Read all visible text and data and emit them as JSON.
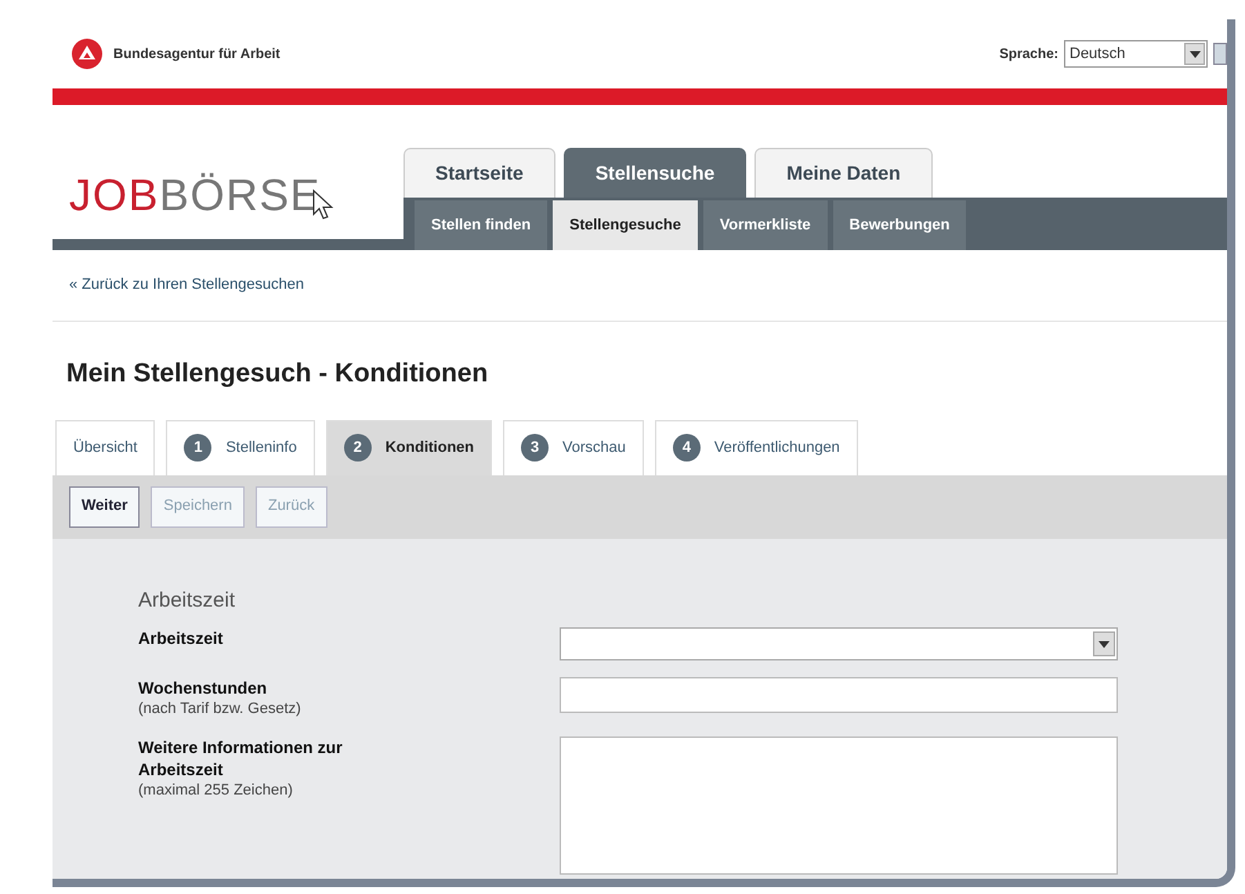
{
  "header": {
    "agency": "Bundesagentur für Arbeit",
    "language_label": "Sprache:",
    "language_value": "Deutsch"
  },
  "logo": {
    "part1": "JOB",
    "part2": "BÖRSE"
  },
  "main_tabs": [
    {
      "label": "Startseite",
      "selected": false
    },
    {
      "label": "Stellensuche",
      "selected": true
    },
    {
      "label": "Meine Daten",
      "selected": false
    }
  ],
  "sub_tabs": [
    {
      "label": "Stellen finden",
      "selected": false
    },
    {
      "label": "Stellengesuche",
      "selected": true
    },
    {
      "label": "Vormerkliste",
      "selected": false
    },
    {
      "label": "Bewerbungen",
      "selected": false
    }
  ],
  "back_link": "« Zurück zu Ihren Stellengesuchen",
  "heading": "Mein Stellengesuch - Konditionen",
  "steps": [
    {
      "label": "Übersicht",
      "selected": false
    },
    {
      "number": "1",
      "label": "Stelleninfo",
      "selected": false
    },
    {
      "number": "2",
      "label": "Konditionen",
      "selected": true
    },
    {
      "number": "3",
      "label": "Vorschau",
      "selected": false
    },
    {
      "number": "4",
      "label": "Veröffentlichungen",
      "selected": false
    }
  ],
  "buttons": [
    {
      "label": "Weiter",
      "disabled": false
    },
    {
      "label": "Speichern",
      "disabled": true
    },
    {
      "label": "Zurück",
      "disabled": true
    }
  ],
  "section_title": "Arbeitszeit",
  "fields": [
    {
      "kind": "select",
      "label": "Arbeitszeit"
    },
    {
      "kind": "text",
      "label": "Wochenstunden",
      "hint": "(nach Tarif bzw. Gesetz)"
    },
    {
      "kind": "textarea",
      "label": "Weitere Informationen zur Arbeitszeit",
      "hint": "(maximal 255 Zeichen)"
    }
  ]
}
